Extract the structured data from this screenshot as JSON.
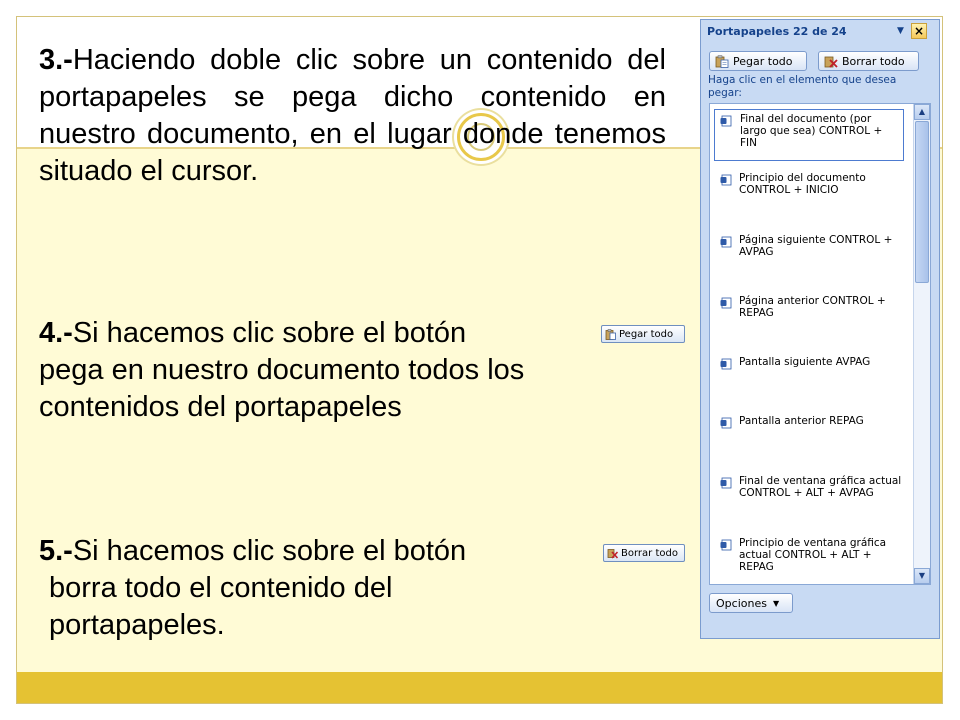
{
  "slide": {
    "point3": {
      "number": "3.-",
      "text": "Haciendo doble clic sobre un contenido del portapapeles se pega dicho contenido en nuestro documento, en el lugar donde tenemos situado el cursor."
    },
    "point4": {
      "number": "4.-",
      "line1": "Si hacemos clic sobre el botón",
      "line2": "pega en nuestro documento todos los",
      "line3": "contenidos del portapapeles",
      "button_label": "Pegar todo"
    },
    "point5": {
      "number": "5.-",
      "line1": "Si hacemos clic sobre el botón",
      "line2": "borra todo el contenido del",
      "line3": "portapapeles.",
      "button_label": "Borrar todo"
    },
    "colors": {
      "bar": "#e5c233",
      "background": "#fffbd6"
    }
  },
  "pane": {
    "title": "Portapapeles 22 de 24",
    "menu_icon": "dropdown-arrow-icon",
    "close_label": "×",
    "paste_all_label": "Pegar todo",
    "clear_all_label": "Borrar todo",
    "hint": "Haga clic en el elemento que desea pegar:",
    "items": [
      {
        "label": "Final del documento (por largo que sea) CONTROL + FIN"
      },
      {
        "label": "Principio del documento CONTROL + INICIO"
      },
      {
        "label": "Página siguiente CONTROL + AVPAG"
      },
      {
        "label": "Página anterior CONTROL + REPAG"
      },
      {
        "label": "Pantalla siguiente AVPAG"
      },
      {
        "label": "Pantalla anterior REPAG"
      },
      {
        "label": "Final de ventana gráfica actual CONTROL + ALT + AVPAG"
      },
      {
        "label": "Principio de ventana gráfica actual CONTROL + ALT + REPAG"
      }
    ],
    "options_label": "Opciones"
  }
}
